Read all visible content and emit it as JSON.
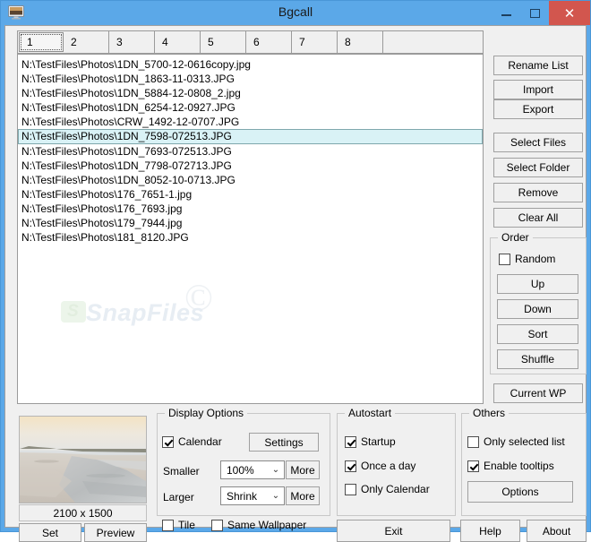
{
  "window": {
    "title": "Bgcall",
    "icon": "monitor-icon",
    "minimize_label": "–",
    "maximize_label": "□",
    "close_label": "✕",
    "close_color": "#d2564e",
    "titlebar_color": "#5ba8e8"
  },
  "tabs": [
    {
      "label": "1",
      "selected": true
    },
    {
      "label": "2",
      "selected": false
    },
    {
      "label": "3",
      "selected": false
    },
    {
      "label": "4",
      "selected": false
    },
    {
      "label": "5",
      "selected": false
    },
    {
      "label": "6",
      "selected": false
    },
    {
      "label": "7",
      "selected": false
    },
    {
      "label": "8",
      "selected": false
    }
  ],
  "file_list": {
    "items": [
      {
        "path": "N:\\TestFiles\\Photos\\1DN_5700-12-0616copy.jpg",
        "selected": false
      },
      {
        "path": "N:\\TestFiles\\Photos\\1DN_1863-11-0313.JPG",
        "selected": false
      },
      {
        "path": "N:\\TestFiles\\Photos\\1DN_5884-12-0808_2.jpg",
        "selected": false
      },
      {
        "path": "N:\\TestFiles\\Photos\\1DN_6254-12-0927.JPG",
        "selected": false
      },
      {
        "path": "N:\\TestFiles\\Photos\\CRW_1492-12-0707.JPG",
        "selected": false
      },
      {
        "path": "N:\\TestFiles\\Photos\\1DN_7598-072513.JPG",
        "selected": true
      },
      {
        "path": "N:\\TestFiles\\Photos\\1DN_7693-072513.JPG",
        "selected": false
      },
      {
        "path": "N:\\TestFiles\\Photos\\1DN_7798-072713.JPG",
        "selected": false
      },
      {
        "path": "N:\\TestFiles\\Photos\\1DN_8052-10-0713.JPG",
        "selected": false
      },
      {
        "path": "N:\\TestFiles\\Photos\\176_7651-1.jpg",
        "selected": false
      },
      {
        "path": "N:\\TestFiles\\Photos\\176_7693.jpg",
        "selected": false
      },
      {
        "path": "N:\\TestFiles\\Photos\\179_7944.jpg",
        "selected": false
      },
      {
        "path": "N:\\TestFiles\\Photos\\181_8120.JPG",
        "selected": false
      }
    ],
    "selection_color": "#d9f2f6"
  },
  "watermark": {
    "copyright": "©",
    "text": "SnapFiles"
  },
  "right_buttons": {
    "rename_list": "Rename List",
    "import": "Import",
    "export": "Export",
    "select_files": "Select Files",
    "select_folder": "Select Folder",
    "remove": "Remove",
    "clear_all": "Clear All",
    "current_wp": "Current WP"
  },
  "order_group": {
    "title": "Order",
    "random": {
      "label": "Random",
      "checked": false
    },
    "up": "Up",
    "down": "Down",
    "sort": "Sort",
    "shuffle": "Shuffle"
  },
  "preview": {
    "dimensions": "2100 x 1500",
    "set": "Set",
    "preview": "Preview"
  },
  "display_options": {
    "title": "Display Options",
    "calendar": {
      "label": "Calendar",
      "checked": true
    },
    "settings": "Settings",
    "smaller_label": "Smaller",
    "smaller_value": "100%",
    "smaller_more": "More",
    "larger_label": "Larger",
    "larger_value": "Shrink",
    "larger_more": "More",
    "tile": {
      "label": "Tile",
      "checked": false
    },
    "same_wallpaper": {
      "label": "Same Wallpaper",
      "checked": false
    }
  },
  "autostart": {
    "title": "Autostart",
    "startup": {
      "label": "Startup",
      "checked": true
    },
    "once_a_day": {
      "label": "Once a day",
      "checked": true
    },
    "only_calendar": {
      "label": "Only Calendar",
      "checked": false
    }
  },
  "others": {
    "title": "Others",
    "only_selected_list": {
      "label": "Only selected list",
      "checked": false
    },
    "enable_tooltips": {
      "label": "Enable tooltips",
      "checked": true
    },
    "options": "Options"
  },
  "footer": {
    "exit": "Exit",
    "help": "Help",
    "about": "About"
  }
}
